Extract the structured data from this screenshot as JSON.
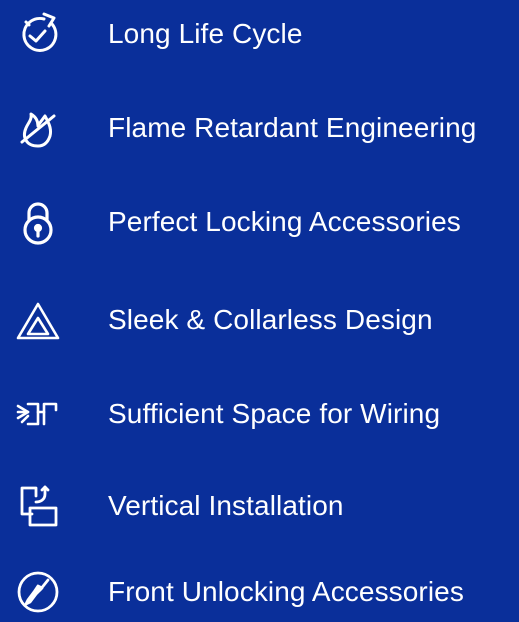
{
  "theme": {
    "background": "#0a2f9a",
    "text_color": "#ffffff",
    "icon_color": "#ffffff"
  },
  "features": [
    {
      "label": "Long Life Cycle",
      "icon": "stopwatch-cycle-icon"
    },
    {
      "label": "Flame Retardant Engineering",
      "icon": "no-flame-icon"
    },
    {
      "label": "Perfect Locking Accessories",
      "icon": "padlock-icon"
    },
    {
      "label": "Sleek & Collarless Design",
      "icon": "triangle-icon"
    },
    {
      "label": "Sufficient Space for Wiring",
      "icon": "wiring-space-icon"
    },
    {
      "label": "Vertical Installation",
      "icon": "vertical-install-icon"
    },
    {
      "label": "Front Unlocking Accessories",
      "icon": "screwdriver-icon"
    }
  ]
}
